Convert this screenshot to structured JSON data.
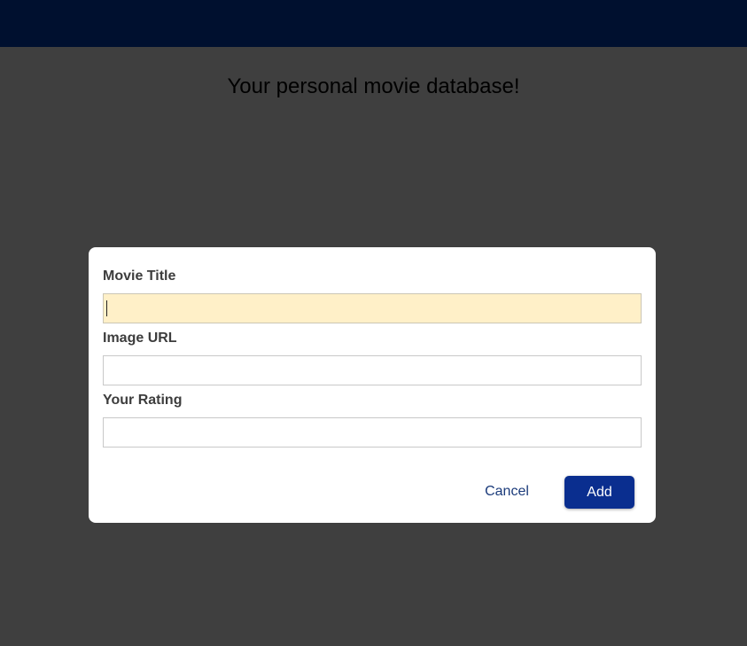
{
  "page": {
    "tagline": "Your personal movie database!"
  },
  "dialog": {
    "fields": [
      {
        "label": "Movie Title",
        "value": "",
        "placeholder": ""
      },
      {
        "label": "Image URL",
        "value": "",
        "placeholder": ""
      },
      {
        "label": "Your Rating",
        "value": "",
        "placeholder": ""
      }
    ],
    "cancel_label": "Cancel",
    "add_label": "Add"
  },
  "colors": {
    "header": "#00102f",
    "backdrop": "#3f3f3f",
    "focused_field": "#fff0c8",
    "primary_button": "#0a2e8f",
    "link": "#1a3a7a"
  }
}
